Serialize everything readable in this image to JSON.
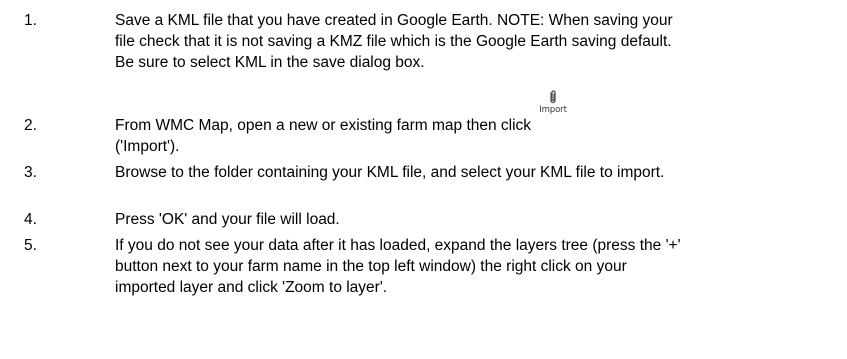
{
  "steps": [
    {
      "number": "1.",
      "text": "Save a KML file that you have created in Google Earth. NOTE: When saving your file check that it is not saving a KMZ file which is the Google Earth saving default. Be sure to select KML in the save dialog box."
    },
    {
      "number": "2.",
      "text": "From WMC Map, open a new or existing farm map then click ('Import')."
    },
    {
      "number": "3.",
      "text": "Browse to the folder containing your KML file, and select your KML file to import."
    },
    {
      "number": "4.",
      "text": "Press 'OK' and your file will load."
    },
    {
      "number": "5.",
      "text": "If you do not see your data after it has loaded, expand the layers tree (press the '+' button next to your farm name in the top left window) the right click on your imported layer and click 'Zoom to layer'."
    }
  ],
  "import_icon": {
    "icon": "paperclip-icon",
    "label": "Import",
    "color": "#555555"
  }
}
